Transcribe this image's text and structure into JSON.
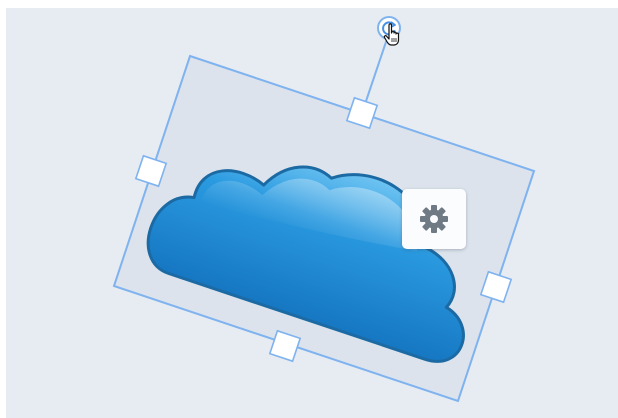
{
  "canvas": {
    "background_color": "#e7ecf2"
  },
  "selected_object": {
    "shape": "cloud",
    "fill_color": "#1e8fd8",
    "outline_color": "#1c6aa3",
    "rotation_deg": 22
  },
  "selection": {
    "frame_color": "#7fb3ef",
    "handles": [
      "top",
      "left",
      "right",
      "bottom"
    ],
    "rotate_handle_icon": "rotate-icon"
  },
  "toolbar": {
    "settings_icon": "gear-icon",
    "gear_color": "#707a85"
  },
  "cursor": {
    "icon": "hand-pointer-icon"
  }
}
